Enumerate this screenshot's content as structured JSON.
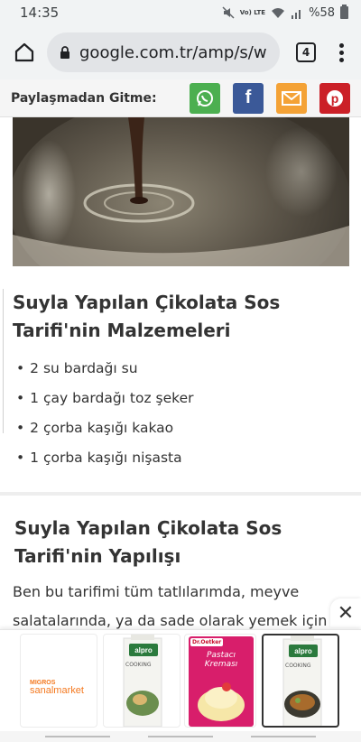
{
  "status": {
    "time": "14:35",
    "network": "Vo) LTE",
    "battery": "%58"
  },
  "browser": {
    "url": "google.com.tr/amp/s/w",
    "tab_count": "4"
  },
  "share": {
    "label": "Paylaşmadan Gitme:",
    "buttons": [
      {
        "name": "whatsapp",
        "color": "#4caf50"
      },
      {
        "name": "facebook",
        "color": "#3b5998",
        "glyph": "f"
      },
      {
        "name": "email",
        "color": "#f4a236"
      },
      {
        "name": "pinterest",
        "color": "#cb2027"
      }
    ]
  },
  "article": {
    "ingredients_title": "Suyla Yapılan Çikolata Sos Tarifi'nin Malzemeleri",
    "ingredients": [
      "2 su bardağı su",
      "1 çay bardağı toz şeker",
      "2 çorba kaşığı kakao",
      "1 çorba kaşığı nişasta"
    ],
    "method_title": "Suyla Yapılan Çikolata Sos Tarifi'nin Yapılışı",
    "method_text": "Ben bu tarifimi tüm tatlılarımda, meyve salatalarında, ya da sade olarak yemek için"
  },
  "ad": {
    "brand_line1": "MIGROS",
    "brand_line2": "sanalmarket",
    "product1_brand": "alpro",
    "product1_sub": "COOKING",
    "product2_brand": "Dr.Oetker",
    "product2_title": "Pastacı Kreması",
    "product3_brand": "alpro",
    "product3_sub": "COOKING",
    "close_glyph": "✕"
  }
}
